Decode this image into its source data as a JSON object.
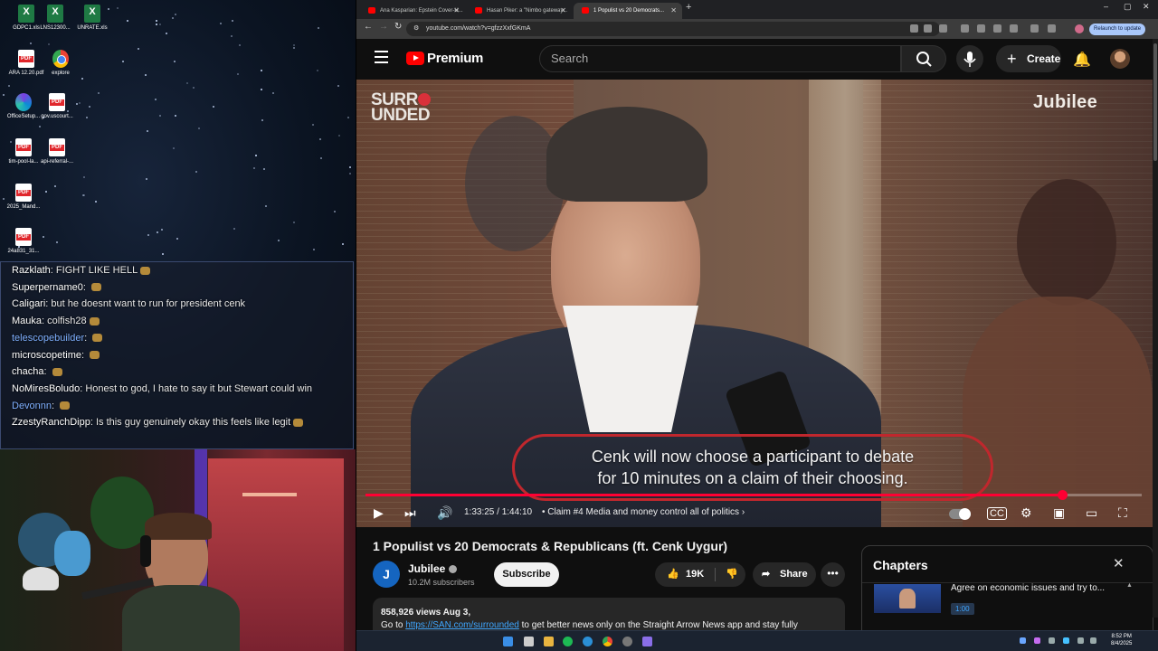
{
  "desktop": {
    "icons": [
      {
        "label": "GDPC1.xls",
        "type": "xls"
      },
      {
        "label": "LNS12300...",
        "type": "xls"
      },
      {
        "label": "UNRATE.xls",
        "type": "xls"
      },
      {
        "label": "ARA 12.20.pdf",
        "type": "pdf"
      },
      {
        "label": "explore",
        "type": "chrome"
      },
      {
        "label": "OfficeSetup...",
        "type": "office"
      },
      {
        "label": "gov.uscourt...",
        "type": "pdf"
      },
      {
        "label": "tim-pool-la...",
        "type": "pdf"
      },
      {
        "label": "api-referral-...",
        "type": "pdf"
      },
      {
        "label": "2025_Mand...",
        "type": "pdf"
      },
      {
        "label": "24a831_31...",
        "type": "pdf"
      }
    ]
  },
  "chat": {
    "messages": [
      {
        "user": "Razklath",
        "text": "FIGHT LIKE HELL",
        "color": "#ffffff"
      },
      {
        "user": "Superpername0",
        "text": "",
        "color": "#ffffff"
      },
      {
        "user": "Caligari",
        "text": "but he doesnt want to run for president cenk",
        "color": "#ffffff"
      },
      {
        "user": "Mauka",
        "text": "colfish28",
        "color": "#ffffff"
      },
      {
        "user": "telescopebuilder",
        "text": "",
        "color": "#7fb0ff"
      },
      {
        "user": "microscopetime",
        "text": "",
        "color": "#ffffff"
      },
      {
        "user": "chacha",
        "text": "",
        "color": "#ffffff"
      },
      {
        "user": "NoMiresBoludo",
        "text": "Honest to god, I hate to say it but Stewart could win",
        "color": "#ffffff"
      },
      {
        "user": "Devonnn",
        "text": "",
        "color": "#7fb0ff"
      },
      {
        "user": "ZzestyRanchDipp",
        "text": "Is this guy genuinely okay this feels like legit",
        "color": "#ffffff"
      }
    ]
  },
  "browser": {
    "tabs": [
      {
        "label": "Ana Kasparian: Epstein Cover-U...",
        "active": false
      },
      {
        "label": "Hasan Piker: a \"Nimbo gateway...",
        "active": false
      },
      {
        "label": "1 Populist vs 20 Democrats...",
        "active": true
      }
    ],
    "url": "youtube.com/watch?v=gfzzXxfGKmA",
    "relaunch_label": "Relaunch to update"
  },
  "youtube": {
    "brand": "Premium",
    "search_placeholder": "Search",
    "create_label": "Create",
    "video": {
      "watermark_left": "SURR\nUNDED",
      "watermark_right": "Jubilee",
      "subtitle_line1": "Cenk will now choose a participant to debate",
      "subtitle_line2": "for 10 minutes on a claim of their choosing.",
      "time": "1:33:25 / 1:44:10",
      "chapter": "Claim #4 Media and money control all of politics",
      "progress": 0.897
    },
    "title": "1 Populist vs 20 Democrats & Republicans (ft. Cenk Uygur)",
    "channel": {
      "name": "Jubilee",
      "subscribers": "10.2M subscribers",
      "initial": "J"
    },
    "subscribe_label": "Subscribe",
    "likes": "19K",
    "share_label": "Share",
    "description": {
      "meta": "858,926 views  Aug 3,",
      "prefix": "Go to ",
      "link": "https://SAN.com/surrounded",
      "suffix": " to get better news only on the Straight Arrow News app and stay fully"
    },
    "chapters_panel": {
      "heading": "Chapters",
      "item_title": "Agree on economic issues and try to...",
      "item_time": "1:00"
    }
  },
  "taskbar": {
    "time": "8:52 PM",
    "date": "8/4/2025"
  }
}
